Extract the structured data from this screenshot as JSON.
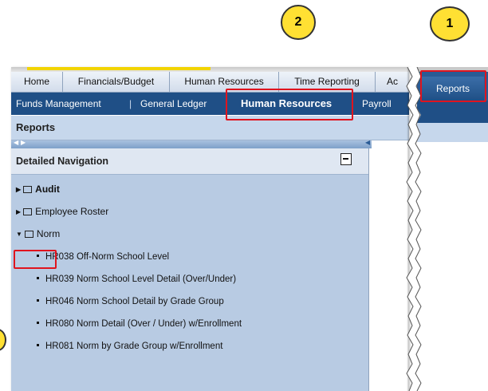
{
  "callouts": {
    "step2": "2",
    "step1": "1"
  },
  "top_tabs": [
    "Home",
    "Financials/Budget",
    "Human Resources",
    "Time Reporting",
    "Ac"
  ],
  "sub_tabs": {
    "funds": "Funds Management",
    "sep1": "|",
    "general_ledger": "General Ledger",
    "human_resources": "Human Resources",
    "payroll": "Payroll"
  },
  "page_title": "Reports",
  "nav": {
    "header": "Detailed Navigation",
    "folders": [
      {
        "label": "Audit",
        "expanded": false
      },
      {
        "label": "Employee Roster",
        "expanded": false
      },
      {
        "label": "Norm",
        "expanded": true
      }
    ],
    "norm_items": [
      "HR038 Off-Norm School Level",
      "HR039 Norm School Level Detail (Over/Under)",
      "HR046 Norm School Detail by Grade Group",
      "HR080 Norm Detail (Over / Under) w/Enrollment",
      "HR081 Norm by Grade Group w/Enrollment"
    ]
  },
  "right_panel": {
    "reports_tab": "Reports"
  },
  "colors": {
    "highlight": "#e0141e",
    "callout_fill": "#ffe033",
    "nav_blue": "#1f4f86",
    "panel_blue": "#b8cbe3"
  },
  "icons": [
    "expand-triangle-icon",
    "collapse-triangle-icon",
    "folder-icon",
    "minimize-icon"
  ]
}
